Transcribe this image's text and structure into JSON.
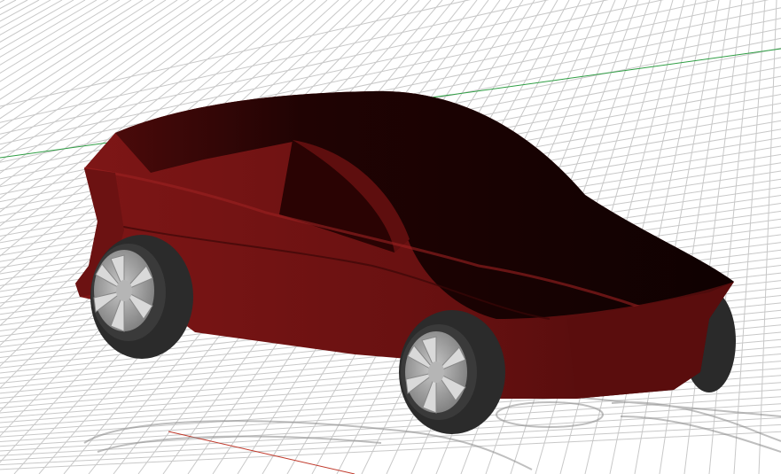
{
  "viewport": {
    "kind": "3d-perspective-viewport",
    "background": "#ffffff",
    "grid_color": "#c8c8c8",
    "x_axis_color": "#c0392b",
    "y_axis_color": "#2f9e44"
  },
  "scene": {
    "object": "car",
    "body_color": "#7a1414",
    "body_shadow_color": "#1a0202",
    "wheel_tire_color": "#2b2b2b",
    "wheel_rim_color": "#9a9a9a"
  }
}
